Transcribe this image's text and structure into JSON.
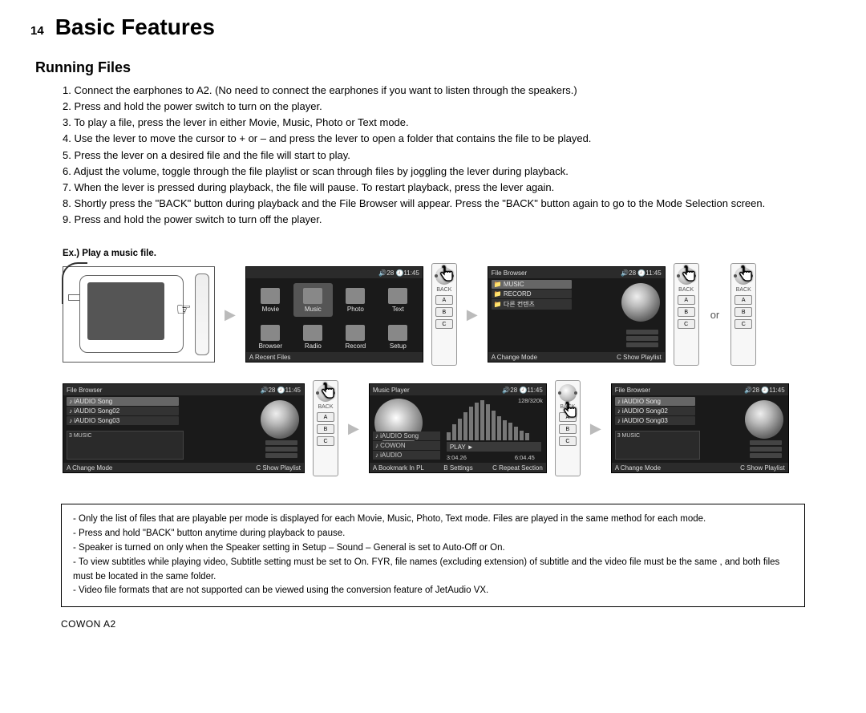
{
  "page_number": "14",
  "title": "Basic Features",
  "subheading": "Running Files",
  "steps": [
    "1. Connect the earphones to A2. (No need to connect the earphones if you want to listen through the speakers.)",
    "2. Press and hold the power switch to turn on the player.",
    "3. To play a file, press the lever in either Movie, Music, Photo or Text mode.",
    "4. Use the lever to move the cursor to + or – and press the lever to open a folder that contains the file to be played.",
    "5. Press the lever on a desired file and the file will start to play.",
    "6. Adjust the volume, toggle through the file playlist or scan through files by joggling the lever during playback.",
    "7. When the lever is pressed during playback, the file will pause. To restart playback, press the lever again.",
    "8. Shortly press the \"BACK\" button during playback and the File Browser will appear. Press the \"BACK\" button again to go to the Mode Selection screen.",
    "9. Press and hold the power switch to turn off the player."
  ],
  "example_label": "Ex.) Play a music file.",
  "or_label": "or",
  "lever_buttons": {
    "back": "BACK",
    "a": "A",
    "b": "B",
    "c": "C"
  },
  "status": {
    "vol": "28",
    "time": "11:45"
  },
  "modes": [
    "Movie",
    "Music",
    "Photo",
    "Text",
    "Browser",
    "Radio",
    "Record",
    "Setup"
  ],
  "mode_screen": {
    "bottom_left": "A Recent Files"
  },
  "browser1": {
    "title": "File Browser",
    "items": [
      "MUSIC",
      "RECORD",
      "다른 컨텐츠"
    ],
    "bottom_left": "A Change Mode",
    "bottom_right": "C Show Playlist"
  },
  "browser2": {
    "title": "File Browser",
    "items": [
      "iAUDIO Song",
      "iAUDIO Song02",
      "iAUDIO Song03"
    ],
    "sub": "3 MUSIC",
    "bottom_left": "A Change Mode",
    "bottom_right": "C Show Playlist"
  },
  "player": {
    "title": "Music Player",
    "rate": "128/320k",
    "play_label": "PLAY ►",
    "time_cur": "3:04.26",
    "time_total": "6:04.45",
    "nowplaying": [
      "iAUDIO Song",
      "COWON",
      "iAUDIO"
    ],
    "bottom_left": "A Bookmark In PL",
    "bottom_mid": "B Settings",
    "bottom_right": "C Repeat Section"
  },
  "browser3": {
    "title": "File Browser",
    "items": [
      "iAUDIO Song",
      "iAUDIO Song02",
      "iAUDIO Song03"
    ],
    "sub": "3 MUSIC",
    "bottom_left": "A Change Mode",
    "bottom_right": "C Show Playlist"
  },
  "notes": [
    "- Only the list of files that are playable per mode is displayed for each Movie, Music, Photo, Text mode. Files are played in the same method for each mode.",
    "- Press and hold \"BACK\" button anytime during playback to pause.",
    "- Speaker is turned on only when the Speaker setting in Setup – Sound – General is set to Auto-Off or On.",
    "- To view subtitles while playing video, Subtitle setting must be set to On. FYR, file names (excluding extension) of subtitle and the video file must be the same , and both files must be located in the same folder.",
    "- Video file formats that are not supported can be viewed using the conversion feature of JetAudio VX."
  ],
  "footer": "COWON A2"
}
